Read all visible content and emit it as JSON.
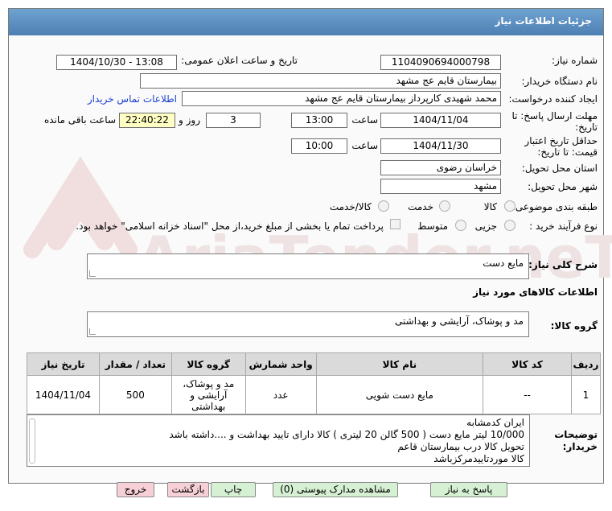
{
  "header": {
    "title": "جزئیات اطلاعات نیاز"
  },
  "form": {
    "need_number_label": "شماره نیاز:",
    "need_number": "1104090694000798",
    "announce_label": "تاریخ و ساعت اعلان عمومی:",
    "announce_value": "1404/10/30 - 13:08",
    "buyer_org_label": "نام دستگاه خریدار:",
    "buyer_org": "بیمارستان قایم  عج  مشهد",
    "creator_label": "ایجاد کننده درخواست:",
    "creator": "محمد شهیدی کارپرداز بیمارستان قایم  عج  مشهد",
    "contact_link": "اطلاعات تماس خریدار",
    "deadline_label_1": "مهلت ارسال پاسخ: تا",
    "deadline_label_2": "تاریخ:",
    "deadline_date": "1404/11/04",
    "time_label": "ساعت",
    "deadline_time": "13:00",
    "days_value": "3",
    "days_label": "روز و",
    "remaining_time": "22:40:22",
    "remaining_label": "ساعت باقی مانده",
    "validity_label_1": "حداقل تاریخ اعتبار",
    "validity_label_2": "قیمت: تا تاریخ:",
    "validity_date": "1404/11/30",
    "validity_time": "10:00",
    "province_label": "استان محل تحویل:",
    "province": "خراسان رضوی",
    "city_label": "شهر محل تحویل:",
    "city": "مشهد",
    "category_label": "طبقه بندی موضوعی:",
    "category_options": [
      "کالا",
      "خدمت",
      "کالا/خدمت"
    ],
    "process_label": "نوع فرآیند خرید :",
    "process_options": [
      "جزیی",
      "متوسط"
    ],
    "payment_note": "پرداخت تمام یا بخشی از مبلغ خرید،از محل \"اسناد خزانه اسلامی\" خواهد بود."
  },
  "summary": {
    "label": "شرح کلی نیاز:",
    "value": "مایع دست"
  },
  "goods_info": {
    "title": "اطلاعات کالاهای مورد نیاز",
    "group_label": "گروه کالا:",
    "group_value": "مد و پوشاک، آرایشی و بهداشتی"
  },
  "table": {
    "headers": [
      "ردیف",
      "کد کالا",
      "نام کالا",
      "واحد شمارش",
      "گروه کالا",
      "تعداد / مقدار",
      "تاریخ نیاز"
    ],
    "rows": [
      {
        "row": "1",
        "code": "--",
        "name": "مایع دست شویی",
        "unit": "عدد",
        "group_1": "مد و پوشاک،",
        "group_2": "آرایشی و",
        "group_3": "بهداشتی",
        "qty": "500",
        "date": "1404/11/04"
      }
    ]
  },
  "notes": {
    "label_1": "توضیحات",
    "label_2": "خریدار:",
    "lines": [
      "ایران کدمشابه",
      "10/000 لیتر مایع  دست  ( 500 گالن 20 لیتری )  کالا  دارای   تایید بهداشت و ....داشته باشد",
      "تحویل کالا درب بیمارستان قاعم",
      "کالا موردتاییدمرکزباشد"
    ]
  },
  "buttons": {
    "reply": "پاسخ به نیاز",
    "docs": "مشاهده مدارک پیوستی (0)",
    "print": "چاپ",
    "back": "بازگشت",
    "exit": "خروج"
  },
  "watermark": {
    "text": "AriaTender.neT"
  },
  "colors": {
    "title_bar": "#5b8dc0",
    "yellow_field": "#ffffc4",
    "link": "#1a3fd1",
    "btn_green": "#d6f0d3",
    "btn_pink": "#f6d0d6"
  }
}
